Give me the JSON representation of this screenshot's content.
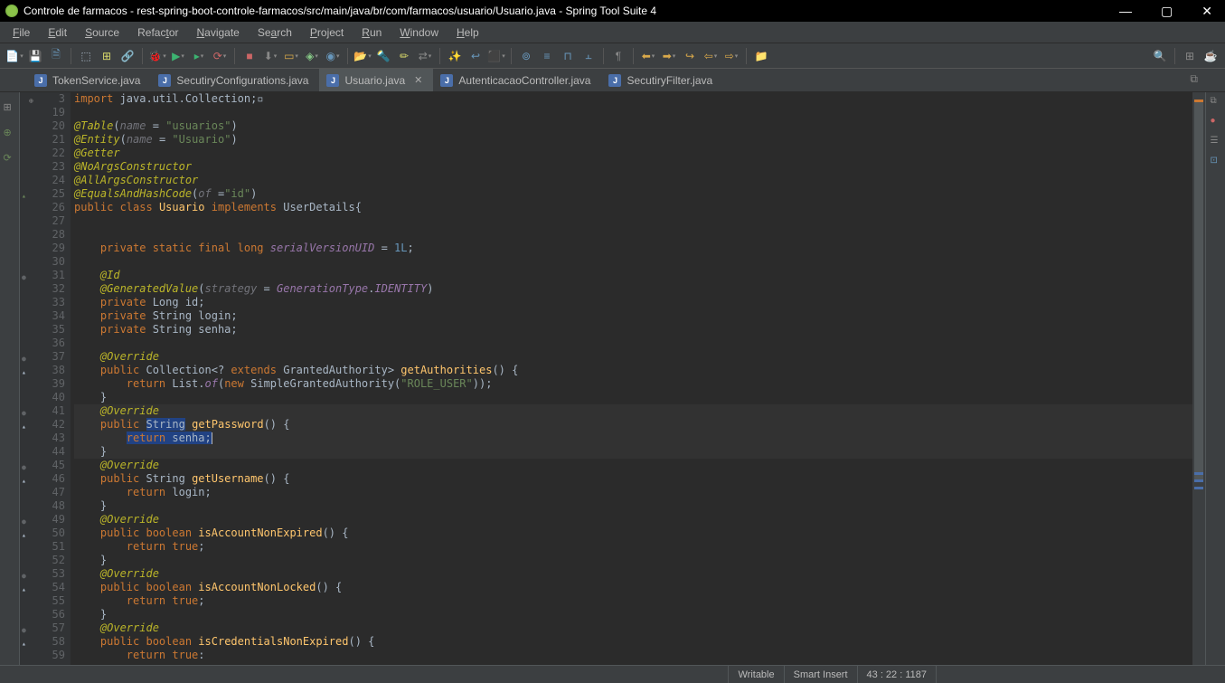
{
  "window": {
    "title": "Controle de farmacos - rest-spring-boot-controle-farmacos/src/main/java/br/com/farmacos/usuario/Usuario.java - Spring Tool Suite 4"
  },
  "menu": {
    "file": "File",
    "edit": "Edit",
    "source": "Source",
    "refactor": "Refactor",
    "navigate": "Navigate",
    "search": "Search",
    "project": "Project",
    "run": "Run",
    "window": "Window",
    "help": "Help"
  },
  "tabs": [
    {
      "label": "TokenService.java",
      "active": false
    },
    {
      "label": "SecutiryConfigurations.java",
      "active": false
    },
    {
      "label": "Usuario.java",
      "active": true,
      "closable": true
    },
    {
      "label": "AutenticacaoController.java",
      "active": false
    },
    {
      "label": "SecutiryFilter.java",
      "active": false
    }
  ],
  "code": {
    "lines": [
      {
        "ln": "3",
        "marker": "fold",
        "html": "<span class='kw'>import</span> java.util.Collection;▫"
      },
      {
        "ln": "19",
        "marker": "",
        "html": ""
      },
      {
        "ln": "20",
        "marker": "",
        "html": "<span class='ann'>@Table</span>(<span class='param'>name</span> = <span class='str'>\"usuarios\"</span>)"
      },
      {
        "ln": "21",
        "marker": "",
        "html": "<span class='ann'>@Entity</span>(<span class='param'>name</span> = <span class='str'>\"Usuario\"</span>)"
      },
      {
        "ln": "22",
        "marker": "",
        "html": "<span class='ann'>@Getter</span>"
      },
      {
        "ln": "23",
        "marker": "",
        "html": "<span class='ann'>@NoArgsConstructor</span>"
      },
      {
        "ln": "24",
        "marker": "",
        "html": "<span class='ann'>@AllArgsConstructor</span>"
      },
      {
        "ln": "25",
        "marker": "greentri",
        "html": "<span class='ann'>@EqualsAndHashCode</span>(<span class='param'>of</span> =<span class='str'>\"id\"</span>)"
      },
      {
        "ln": "26",
        "marker": "",
        "html": "<span class='kw'>public class</span> <span class='cls'>Usuario</span> <span class='kw'>implements</span> UserDetails{"
      },
      {
        "ln": "27",
        "marker": "",
        "html": ""
      },
      {
        "ln": "28",
        "marker": "",
        "html": "    "
      },
      {
        "ln": "29",
        "marker": "",
        "html": "    <span class='kw'>private static final long</span> <span class='fld'>serialVersionUID</span> = <span class='num'>1L</span>;"
      },
      {
        "ln": "30",
        "marker": "",
        "html": ""
      },
      {
        "ln": "31",
        "marker": "circle",
        "html": "    <span class='ann'>@Id</span>"
      },
      {
        "ln": "32",
        "marker": "",
        "html": "    <span class='ann'>@GeneratedValue</span>(<span class='param'>strategy</span> = <span class='fld'>GenerationType</span>.<span class='fld'>IDENTITY</span>)"
      },
      {
        "ln": "33",
        "marker": "",
        "html": "    <span class='kw'>private</span> Long id;"
      },
      {
        "ln": "34",
        "marker": "",
        "html": "    <span class='kw'>private</span> String login;"
      },
      {
        "ln": "35",
        "marker": "",
        "html": "    <span class='kw'>private</span> String senha;"
      },
      {
        "ln": "36",
        "marker": "",
        "html": "    "
      },
      {
        "ln": "37",
        "marker": "circle",
        "html": "    <span class='ann'>@Override</span>"
      },
      {
        "ln": "38",
        "marker": "triangle",
        "html": "    <span class='kw'>public</span> Collection&lt;? <span class='kw'>extends</span> GrantedAuthority&gt; <span class='mtd'>getAuthorities</span>() {"
      },
      {
        "ln": "39",
        "marker": "",
        "html": "        <span class='kw'>return</span> List.<span class='fld'>of</span>(<span class='kw'>new</span> SimpleGrantedAuthority(<span class='str'>\"ROLE_USER\"</span>));"
      },
      {
        "ln": "40",
        "marker": "",
        "html": "    }"
      },
      {
        "ln": "41",
        "marker": "circle",
        "html": "    <span class='ann'>@Override</span>",
        "hl": true
      },
      {
        "ln": "42",
        "marker": "triangle",
        "html": "    <span class='kw'>public</span> <span class='sel'>String</span> <span class='mtd'>getPassword</span>() {",
        "hl": true
      },
      {
        "ln": "43",
        "marker": "",
        "html": "        <span class='sel'><span class='kw'>return</span> senha;</span><span class='cursor'></span>",
        "hl": true
      },
      {
        "ln": "44",
        "marker": "",
        "html": "    }",
        "hl": true
      },
      {
        "ln": "45",
        "marker": "circle",
        "html": "    <span class='ann'>@Override</span>"
      },
      {
        "ln": "46",
        "marker": "triangle",
        "html": "    <span class='kw'>public</span> String <span class='mtd'>getUsername</span>() {"
      },
      {
        "ln": "47",
        "marker": "",
        "html": "        <span class='kw'>return</span> login;"
      },
      {
        "ln": "48",
        "marker": "",
        "html": "    }"
      },
      {
        "ln": "49",
        "marker": "circle",
        "html": "    <span class='ann'>@Override</span>"
      },
      {
        "ln": "50",
        "marker": "triangle",
        "html": "    <span class='kw'>public boolean</span> <span class='mtd'>isAccountNonExpired</span>() {"
      },
      {
        "ln": "51",
        "marker": "",
        "html": "        <span class='kw'>return true</span>;"
      },
      {
        "ln": "52",
        "marker": "",
        "html": "    }"
      },
      {
        "ln": "53",
        "marker": "circle",
        "html": "    <span class='ann'>@Override</span>"
      },
      {
        "ln": "54",
        "marker": "triangle",
        "html": "    <span class='kw'>public boolean</span> <span class='mtd'>isAccountNonLocked</span>() {"
      },
      {
        "ln": "55",
        "marker": "",
        "html": "        <span class='kw'>return true</span>;"
      },
      {
        "ln": "56",
        "marker": "",
        "html": "    }"
      },
      {
        "ln": "57",
        "marker": "circle",
        "html": "    <span class='ann'>@Override</span>"
      },
      {
        "ln": "58",
        "marker": "triangle",
        "html": "    <span class='kw'>public boolean</span> <span class='mtd'>isCredentialsNonExpired</span>() {"
      },
      {
        "ln": "59",
        "marker": "",
        "html": "        <span class='kw'>return true</span>:"
      }
    ]
  },
  "status": {
    "writable": "Writable",
    "insert": "Smart Insert",
    "pos": "43 : 22 : 1187"
  }
}
